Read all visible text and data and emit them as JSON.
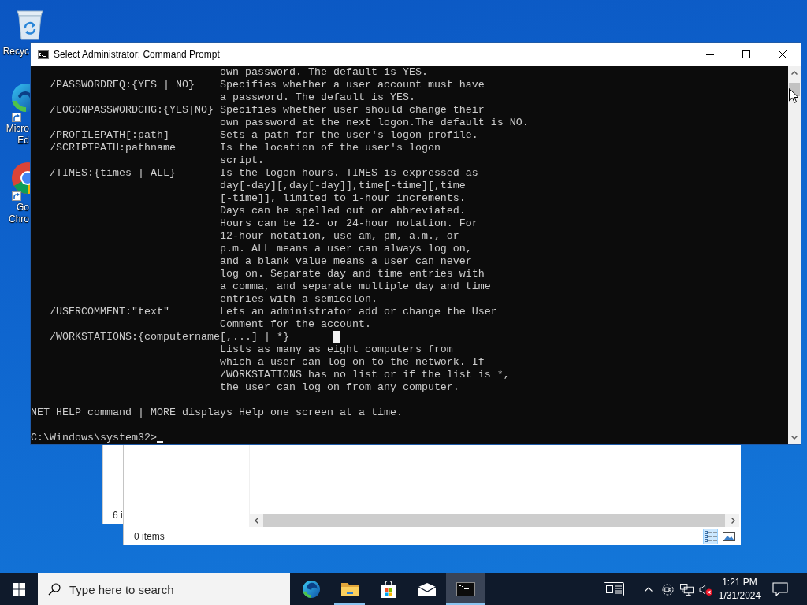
{
  "desktop_icons": [
    {
      "label_lines": [
        "Recyc"
      ],
      "shortcut": false
    },
    {
      "label_lines": [
        "Micro",
        "Ed"
      ],
      "shortcut": true
    },
    {
      "label_lines": [
        "Go",
        "Chro"
      ],
      "shortcut": true
    }
  ],
  "back_window": {
    "status": "6 i"
  },
  "explorer_window": {
    "status": "0 items",
    "view_buttons": [
      {
        "selected": true
      },
      {
        "selected": false
      }
    ]
  },
  "console_window": {
    "title": "Select Administrator: Command Prompt",
    "entries": [
      {
        "description": [
          "own password. The default is YES."
        ],
        "selection_cursor": false
      },
      {
        "option": "/PASSWORDREQ:{YES | NO}",
        "description": [
          "Specifies whether a user account must have",
          "a password. The default is YES."
        ],
        "selection_cursor": false
      },
      {
        "option": "/LOGONPASSWORDCHG:{YES|NO}",
        "description": [
          "Specifies whether user should change their",
          "own password at the next logon.The default is NO."
        ],
        "selection_cursor": false
      },
      {
        "option": "/PROFILEPATH[:path]",
        "description": [
          "Sets a path for the user's logon profile."
        ],
        "selection_cursor": false
      },
      {
        "option": "/SCRIPTPATH:pathname",
        "description": [
          "Is the location of the user's logon",
          "script."
        ],
        "selection_cursor": false
      },
      {
        "option": "/TIMES:{times | ALL}",
        "description": [
          "Is the logon hours. TIMES is expressed as",
          "day[-day][,day[-day]],time[-time][,time",
          "[-time]], limited to 1-hour increments.",
          "Days can be spelled out or abbreviated.",
          "Hours can be 12- or 24-hour notation. For",
          "12-hour notation, use am, pm, a.m., or",
          "p.m. ALL means a user can always log on,",
          "and a blank value means a user can never",
          "log on. Separate day and time entries with",
          "a comma, and separate multiple day and time",
          "entries with a semicolon."
        ],
        "selection_cursor": false
      },
      {
        "option": "/USERCOMMENT:\"text\"",
        "description": [
          "Lets an administrator add or change the User",
          "Comment for the account."
        ],
        "selection_cursor": false
      },
      {
        "option": "/WORKSTATIONS:{computername[,...] | *}",
        "description": [
          "Lists as many as eight computers from",
          "which a user can log on to the network. If",
          "/WORKSTATIONS has no list or if the list is *,",
          "the user can log on from any computer."
        ],
        "selection_cursor": true
      }
    ],
    "footer": "NET HELP command | MORE displays Help one screen at a time.",
    "prompt": "C:\\Windows\\system32>"
  },
  "taskbar": {
    "search": {
      "placeholder": "Type here to search"
    },
    "pinned_apps": [
      {
        "running": false,
        "active": false
      },
      {
        "running": true,
        "active": false
      },
      {
        "running": false,
        "active": false
      },
      {
        "running": false,
        "active": false
      },
      {
        "running": true,
        "active": true
      }
    ],
    "tray": {
      "volume_muted": true
    },
    "clock": {
      "time": "1:21 PM",
      "date": "1/31/2024"
    }
  }
}
